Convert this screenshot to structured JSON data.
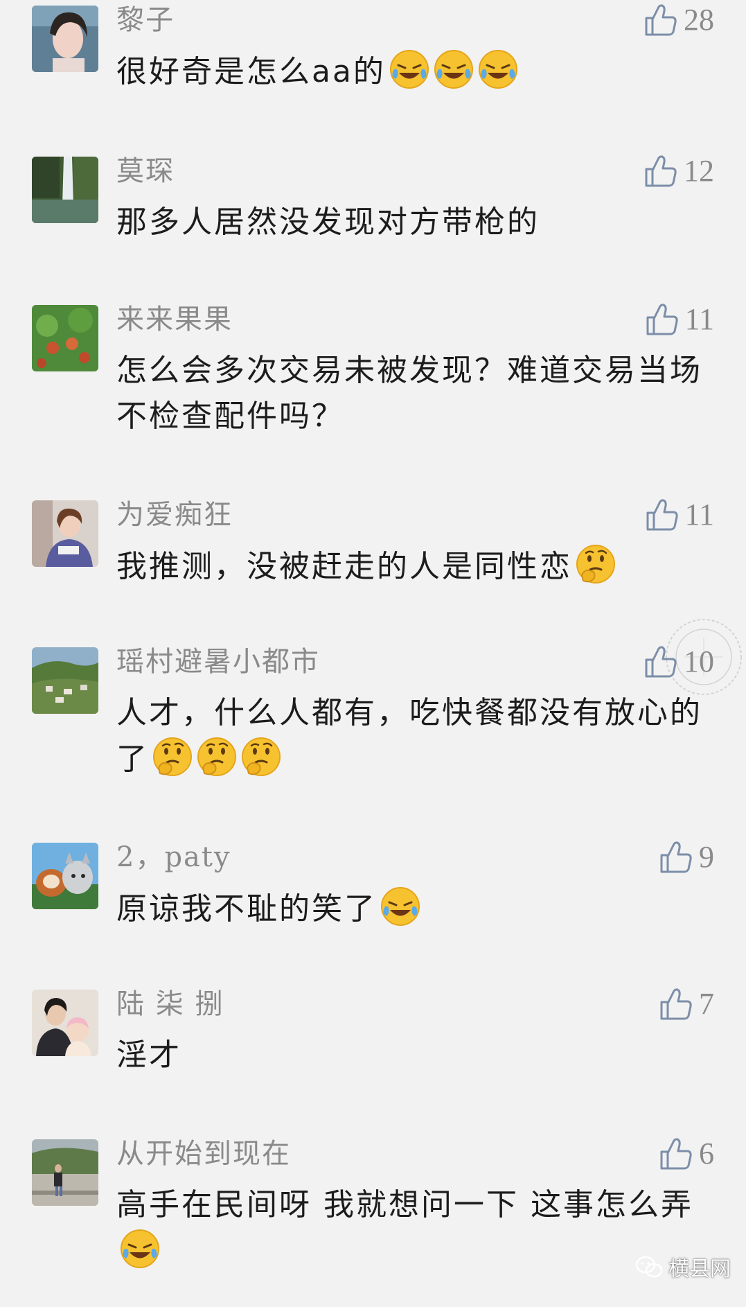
{
  "comments": [
    {
      "user": "黎子",
      "likes": "28",
      "text": "很好奇是怎么aa的",
      "emoji": [
        "laugh-cry",
        "laugh-cry",
        "laugh-cry"
      ]
    },
    {
      "user": "莫琛",
      "likes": "12",
      "text": "那多人居然没发现对方带枪的",
      "emoji": []
    },
    {
      "user": "来来果果",
      "likes": "11",
      "text": "怎么会多次交易未被发现？难道交易当场不检查配件吗？",
      "emoji": []
    },
    {
      "user": "为爱痴狂",
      "likes": "11",
      "text": "我推测，没被赶走的人是同性恋",
      "emoji": [
        "thinking"
      ]
    },
    {
      "user": "瑶村避暑小都市",
      "likes": "10",
      "text": "人才，什么人都有，吃快餐都没有放心的了",
      "emoji": [
        "thinking",
        "thinking",
        "thinking"
      ]
    },
    {
      "user": "2，paty",
      "likes": "9",
      "text": "原谅我不耻的笑了",
      "emoji": [
        "laugh-cry"
      ]
    },
    {
      "user": "陆 柒 捌",
      "likes": "7",
      "text": "淫才",
      "emoji": []
    },
    {
      "user": "从开始到现在",
      "likes": "6",
      "text": "高手在民间呀 我就想问一下 这事怎么弄",
      "emoji": [
        "laugh-cry"
      ]
    }
  ],
  "watermark": {
    "brand": "横县网"
  },
  "icons": {
    "like": "thumbs-up-icon",
    "brand": "wechat-icon"
  },
  "colors": {
    "background": "#f2f2f2",
    "username": "#8a8a8a",
    "text": "#1c1c1c"
  }
}
